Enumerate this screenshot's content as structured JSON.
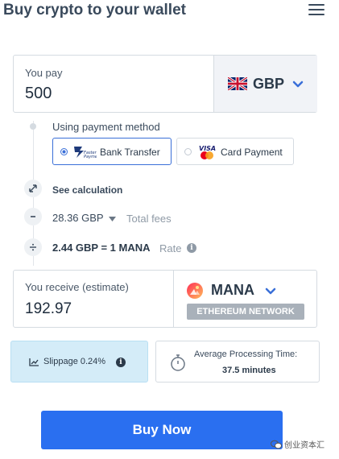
{
  "header": {
    "title": "Buy crypto to your wallet",
    "menu_icon": "hamburger-menu-icon"
  },
  "pay": {
    "label": "You pay",
    "value": "500",
    "currency": "GBP",
    "flag_icon": "uk-flag-icon"
  },
  "payment_method": {
    "label": "Using payment method",
    "options": [
      {
        "label": "Bank Transfer",
        "logo_text": "Faster Payments",
        "selected": true
      },
      {
        "label": "Card Payment",
        "logo_text": "VISA",
        "selected": false
      }
    ]
  },
  "calculation": {
    "label": "See calculation"
  },
  "fees": {
    "amount": "28.36 GBP",
    "label": "Total fees"
  },
  "rate": {
    "value": "2.44 GBP = 1 MANA",
    "label": "Rate"
  },
  "receive": {
    "label": "You receive (estimate)",
    "value": "192.97",
    "currency": "MANA",
    "network": "ETHEREUM NETWORK"
  },
  "slippage": {
    "label": "Slippage 0.24%"
  },
  "processing": {
    "label": "Average Processing Time:",
    "value": "37.5 minutes"
  },
  "buy_button": {
    "label": "Buy Now"
  },
  "watermark": {
    "text": "创业资本汇"
  },
  "colors": {
    "primary": "#2a6ff0",
    "accent_blue": "#3a6fd8",
    "slippage_bg": "#d4ecf8",
    "network_badge": "#a9b1ba"
  }
}
